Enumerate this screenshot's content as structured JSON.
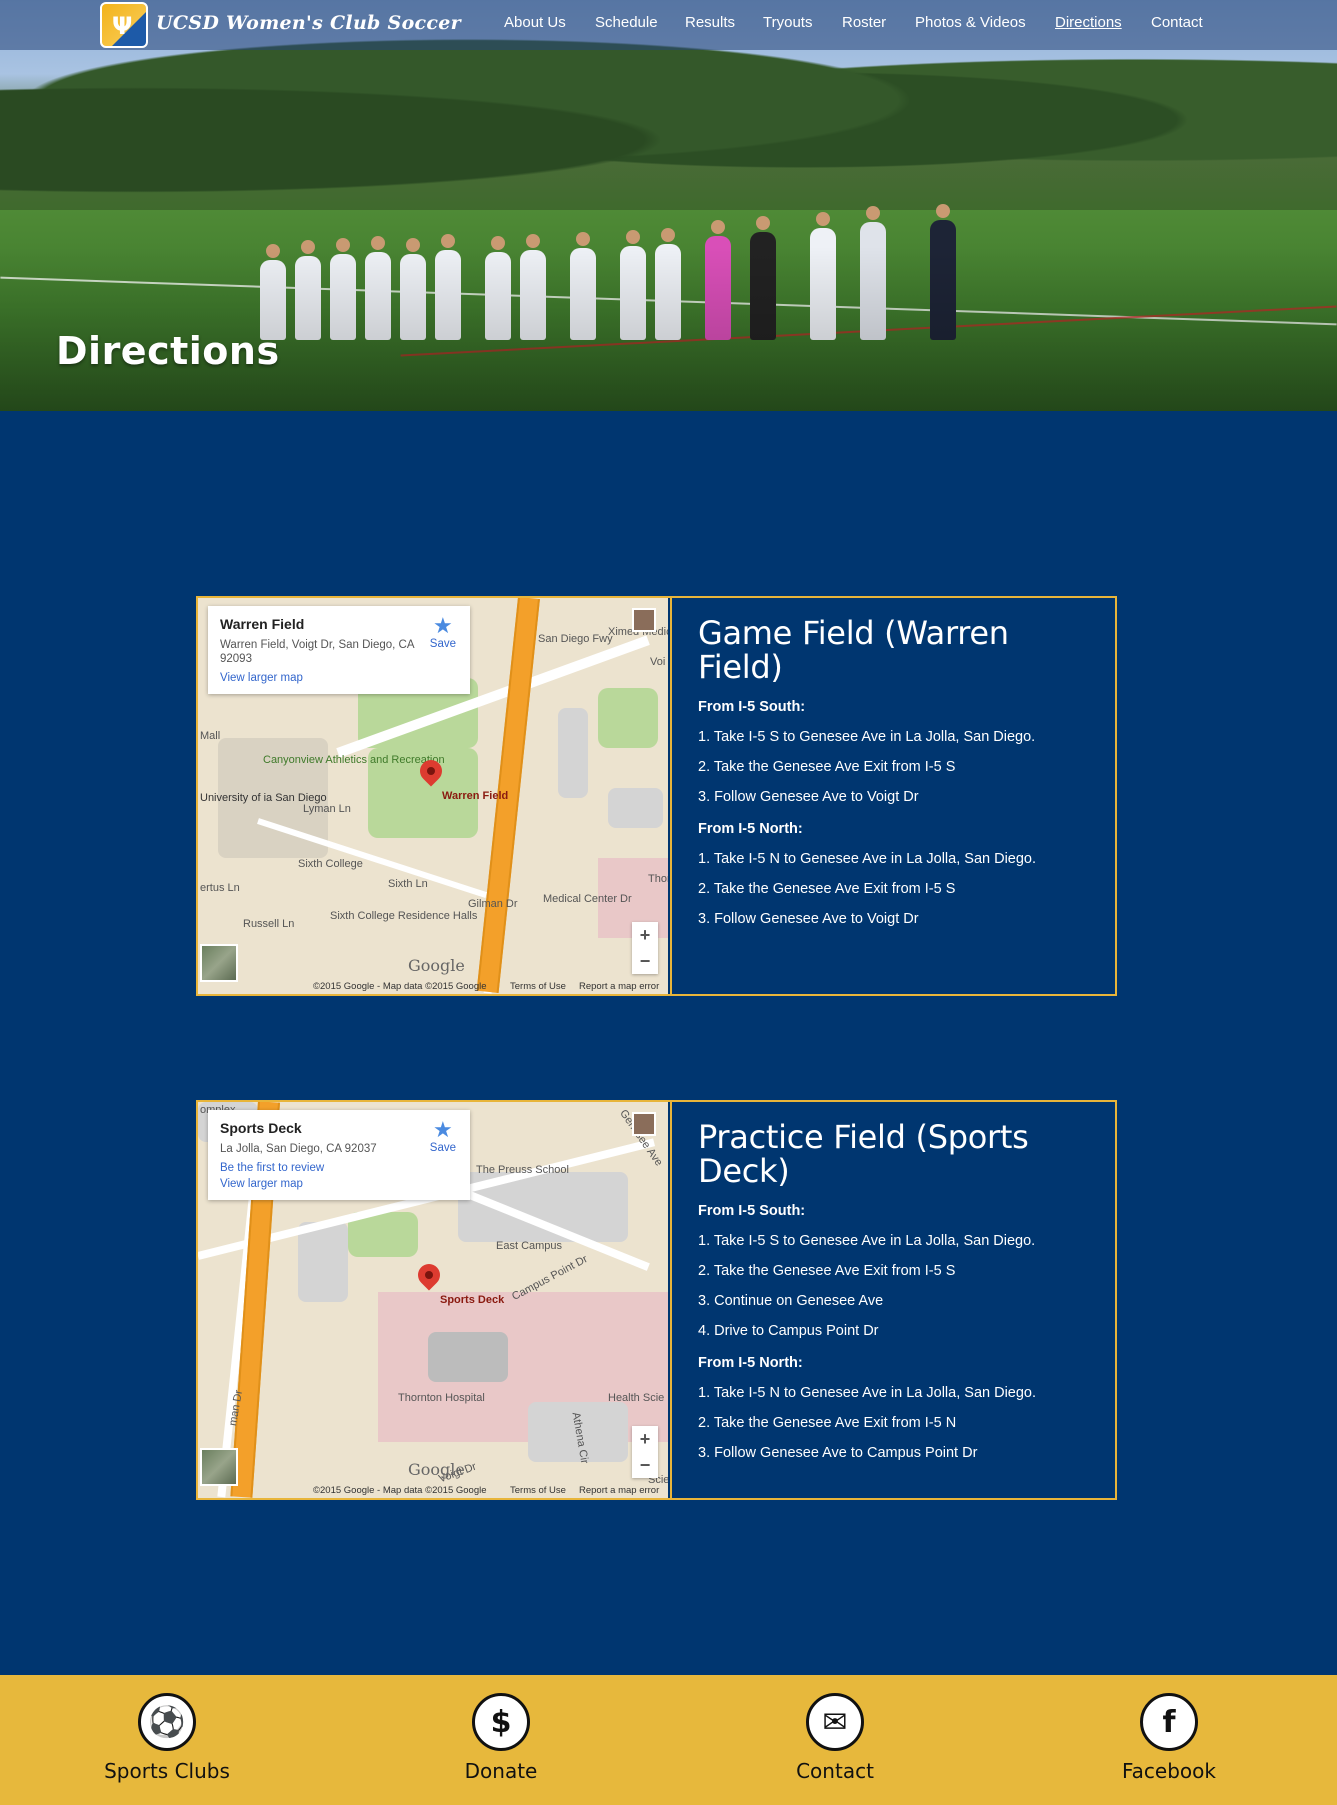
{
  "header": {
    "site_title": "UCSD Women's Club Soccer",
    "nav": [
      {
        "label": "About Us",
        "active": false
      },
      {
        "label": "Schedule",
        "active": false
      },
      {
        "label": "Results",
        "active": false
      },
      {
        "label": "Tryouts",
        "active": false
      },
      {
        "label": "Roster",
        "active": false
      },
      {
        "label": "Photos & Videos",
        "active": false
      },
      {
        "label": "Directions",
        "active": true
      },
      {
        "label": "Contact",
        "active": false
      }
    ]
  },
  "hero": {
    "page_title": "Directions"
  },
  "locations": [
    {
      "map": {
        "place_name": "Warren Field",
        "address": "Warren Field, Voigt Dr, San Diego, CA 92093",
        "links": [
          "View larger map"
        ],
        "save_label": "Save",
        "pin_label": "Warren Field",
        "labels": [
          "Canyonview Athletics and Recreation",
          "University of ia San Diego",
          "Lyman Ln",
          "Sixth College",
          "Sixth Ln",
          "Sixth College Residence Halls",
          "Russell Ln",
          "ertus Ln",
          "Gilman Dr",
          "Medical Center Dr",
          "San Diego Fwy",
          "Mall",
          "Ximed Medic",
          "Thor",
          "Voi"
        ],
        "footer": [
          "©2015 Google - Map data ©2015 Google",
          "Terms of Use",
          "Report a map error"
        ],
        "google_mark": "Google"
      },
      "title": "Game Field (Warren Field)",
      "sections": [
        {
          "heading": "From I-5 South:",
          "steps": [
            "1. Take I-5 S to Genesee Ave in La Jolla, San Diego.",
            "2. Take the Genesee Ave Exit from I-5 S",
            "3. Follow Genesee Ave to Voigt Dr"
          ]
        },
        {
          "heading": "From I-5 North:",
          "steps": [
            "1. Take I-5 N to Genesee Ave in La Jolla, San Diego.",
            "2. Take the Genesee Ave Exit from I-5 S",
            "3. Follow Genesee Ave to Voigt Dr"
          ]
        }
      ]
    },
    {
      "map": {
        "place_name": "Sports Deck",
        "address": "La Jolla, San Diego, CA 92037",
        "links": [
          "Be the first to review",
          "View larger map"
        ],
        "save_label": "Save",
        "pin_label": "Sports Deck",
        "labels": [
          "The Preuss School",
          "East Campus",
          "Campus Point Dr",
          "Thornton Hospital",
          "Health Scie",
          "Athena Cir",
          "Genesee Ave",
          "man Dr",
          "omplex",
          "Scie",
          "Voigt Dr"
        ],
        "footer": [
          "©2015 Google - Map data ©2015 Google",
          "Terms of Use",
          "Report a map error"
        ],
        "google_mark": "Google"
      },
      "title": "Practice Field (Sports Deck)",
      "sections": [
        {
          "heading": "From I-5 South:",
          "steps": [
            "1. Take I-5 S to Genesee Ave in La Jolla, San Diego.",
            "2. Take the Genesee Ave Exit from I-5 S",
            "3. Continue on Genesee Ave",
            "4. Drive to Campus Point Dr"
          ]
        },
        {
          "heading": "From I-5 North:",
          "steps": [
            "1. Take I-5 N to Genesee Ave in La Jolla, San Diego.",
            "2. Take the Genesee Ave Exit from I-5 N",
            "3. Follow Genesee Ave to Campus Point Dr"
          ]
        }
      ]
    }
  ],
  "footer": {
    "items": [
      {
        "label": "Sports Clubs",
        "icon": "soccer-ball-icon",
        "glyph": "⚽"
      },
      {
        "label": "Donate",
        "icon": "dollar-icon",
        "glyph": "$"
      },
      {
        "label": "Contact",
        "icon": "envelope-icon",
        "glyph": "✉"
      },
      {
        "label": "Facebook",
        "icon": "facebook-icon",
        "glyph": "f"
      }
    ]
  },
  "colors": {
    "page_bg": "#003670",
    "accent": "#e8b53a",
    "footer_bg": "#e7b83c"
  }
}
